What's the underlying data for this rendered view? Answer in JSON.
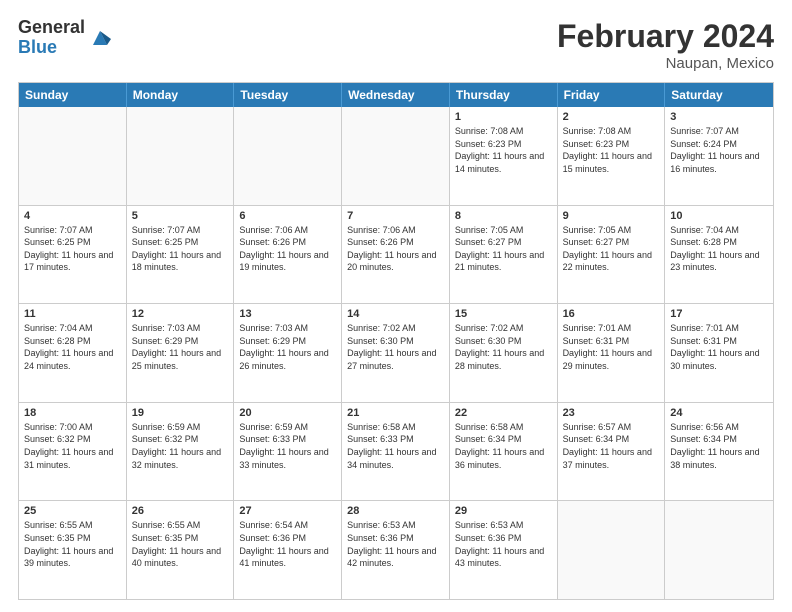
{
  "header": {
    "logo_general": "General",
    "logo_blue": "Blue",
    "title": "February 2024",
    "location": "Naupan, Mexico"
  },
  "days_of_week": [
    "Sunday",
    "Monday",
    "Tuesday",
    "Wednesday",
    "Thursday",
    "Friday",
    "Saturday"
  ],
  "weeks": [
    [
      {
        "day": "",
        "info": ""
      },
      {
        "day": "",
        "info": ""
      },
      {
        "day": "",
        "info": ""
      },
      {
        "day": "",
        "info": ""
      },
      {
        "day": "1",
        "info": "Sunrise: 7:08 AM\nSunset: 6:23 PM\nDaylight: 11 hours and 14 minutes."
      },
      {
        "day": "2",
        "info": "Sunrise: 7:08 AM\nSunset: 6:23 PM\nDaylight: 11 hours and 15 minutes."
      },
      {
        "day": "3",
        "info": "Sunrise: 7:07 AM\nSunset: 6:24 PM\nDaylight: 11 hours and 16 minutes."
      }
    ],
    [
      {
        "day": "4",
        "info": "Sunrise: 7:07 AM\nSunset: 6:25 PM\nDaylight: 11 hours and 17 minutes."
      },
      {
        "day": "5",
        "info": "Sunrise: 7:07 AM\nSunset: 6:25 PM\nDaylight: 11 hours and 18 minutes."
      },
      {
        "day": "6",
        "info": "Sunrise: 7:06 AM\nSunset: 6:26 PM\nDaylight: 11 hours and 19 minutes."
      },
      {
        "day": "7",
        "info": "Sunrise: 7:06 AM\nSunset: 6:26 PM\nDaylight: 11 hours and 20 minutes."
      },
      {
        "day": "8",
        "info": "Sunrise: 7:05 AM\nSunset: 6:27 PM\nDaylight: 11 hours and 21 minutes."
      },
      {
        "day": "9",
        "info": "Sunrise: 7:05 AM\nSunset: 6:27 PM\nDaylight: 11 hours and 22 minutes."
      },
      {
        "day": "10",
        "info": "Sunrise: 7:04 AM\nSunset: 6:28 PM\nDaylight: 11 hours and 23 minutes."
      }
    ],
    [
      {
        "day": "11",
        "info": "Sunrise: 7:04 AM\nSunset: 6:28 PM\nDaylight: 11 hours and 24 minutes."
      },
      {
        "day": "12",
        "info": "Sunrise: 7:03 AM\nSunset: 6:29 PM\nDaylight: 11 hours and 25 minutes."
      },
      {
        "day": "13",
        "info": "Sunrise: 7:03 AM\nSunset: 6:29 PM\nDaylight: 11 hours and 26 minutes."
      },
      {
        "day": "14",
        "info": "Sunrise: 7:02 AM\nSunset: 6:30 PM\nDaylight: 11 hours and 27 minutes."
      },
      {
        "day": "15",
        "info": "Sunrise: 7:02 AM\nSunset: 6:30 PM\nDaylight: 11 hours and 28 minutes."
      },
      {
        "day": "16",
        "info": "Sunrise: 7:01 AM\nSunset: 6:31 PM\nDaylight: 11 hours and 29 minutes."
      },
      {
        "day": "17",
        "info": "Sunrise: 7:01 AM\nSunset: 6:31 PM\nDaylight: 11 hours and 30 minutes."
      }
    ],
    [
      {
        "day": "18",
        "info": "Sunrise: 7:00 AM\nSunset: 6:32 PM\nDaylight: 11 hours and 31 minutes."
      },
      {
        "day": "19",
        "info": "Sunrise: 6:59 AM\nSunset: 6:32 PM\nDaylight: 11 hours and 32 minutes."
      },
      {
        "day": "20",
        "info": "Sunrise: 6:59 AM\nSunset: 6:33 PM\nDaylight: 11 hours and 33 minutes."
      },
      {
        "day": "21",
        "info": "Sunrise: 6:58 AM\nSunset: 6:33 PM\nDaylight: 11 hours and 34 minutes."
      },
      {
        "day": "22",
        "info": "Sunrise: 6:58 AM\nSunset: 6:34 PM\nDaylight: 11 hours and 36 minutes."
      },
      {
        "day": "23",
        "info": "Sunrise: 6:57 AM\nSunset: 6:34 PM\nDaylight: 11 hours and 37 minutes."
      },
      {
        "day": "24",
        "info": "Sunrise: 6:56 AM\nSunset: 6:34 PM\nDaylight: 11 hours and 38 minutes."
      }
    ],
    [
      {
        "day": "25",
        "info": "Sunrise: 6:55 AM\nSunset: 6:35 PM\nDaylight: 11 hours and 39 minutes."
      },
      {
        "day": "26",
        "info": "Sunrise: 6:55 AM\nSunset: 6:35 PM\nDaylight: 11 hours and 40 minutes."
      },
      {
        "day": "27",
        "info": "Sunrise: 6:54 AM\nSunset: 6:36 PM\nDaylight: 11 hours and 41 minutes."
      },
      {
        "day": "28",
        "info": "Sunrise: 6:53 AM\nSunset: 6:36 PM\nDaylight: 11 hours and 42 minutes."
      },
      {
        "day": "29",
        "info": "Sunrise: 6:53 AM\nSunset: 6:36 PM\nDaylight: 11 hours and 43 minutes."
      },
      {
        "day": "",
        "info": ""
      },
      {
        "day": "",
        "info": ""
      }
    ]
  ]
}
